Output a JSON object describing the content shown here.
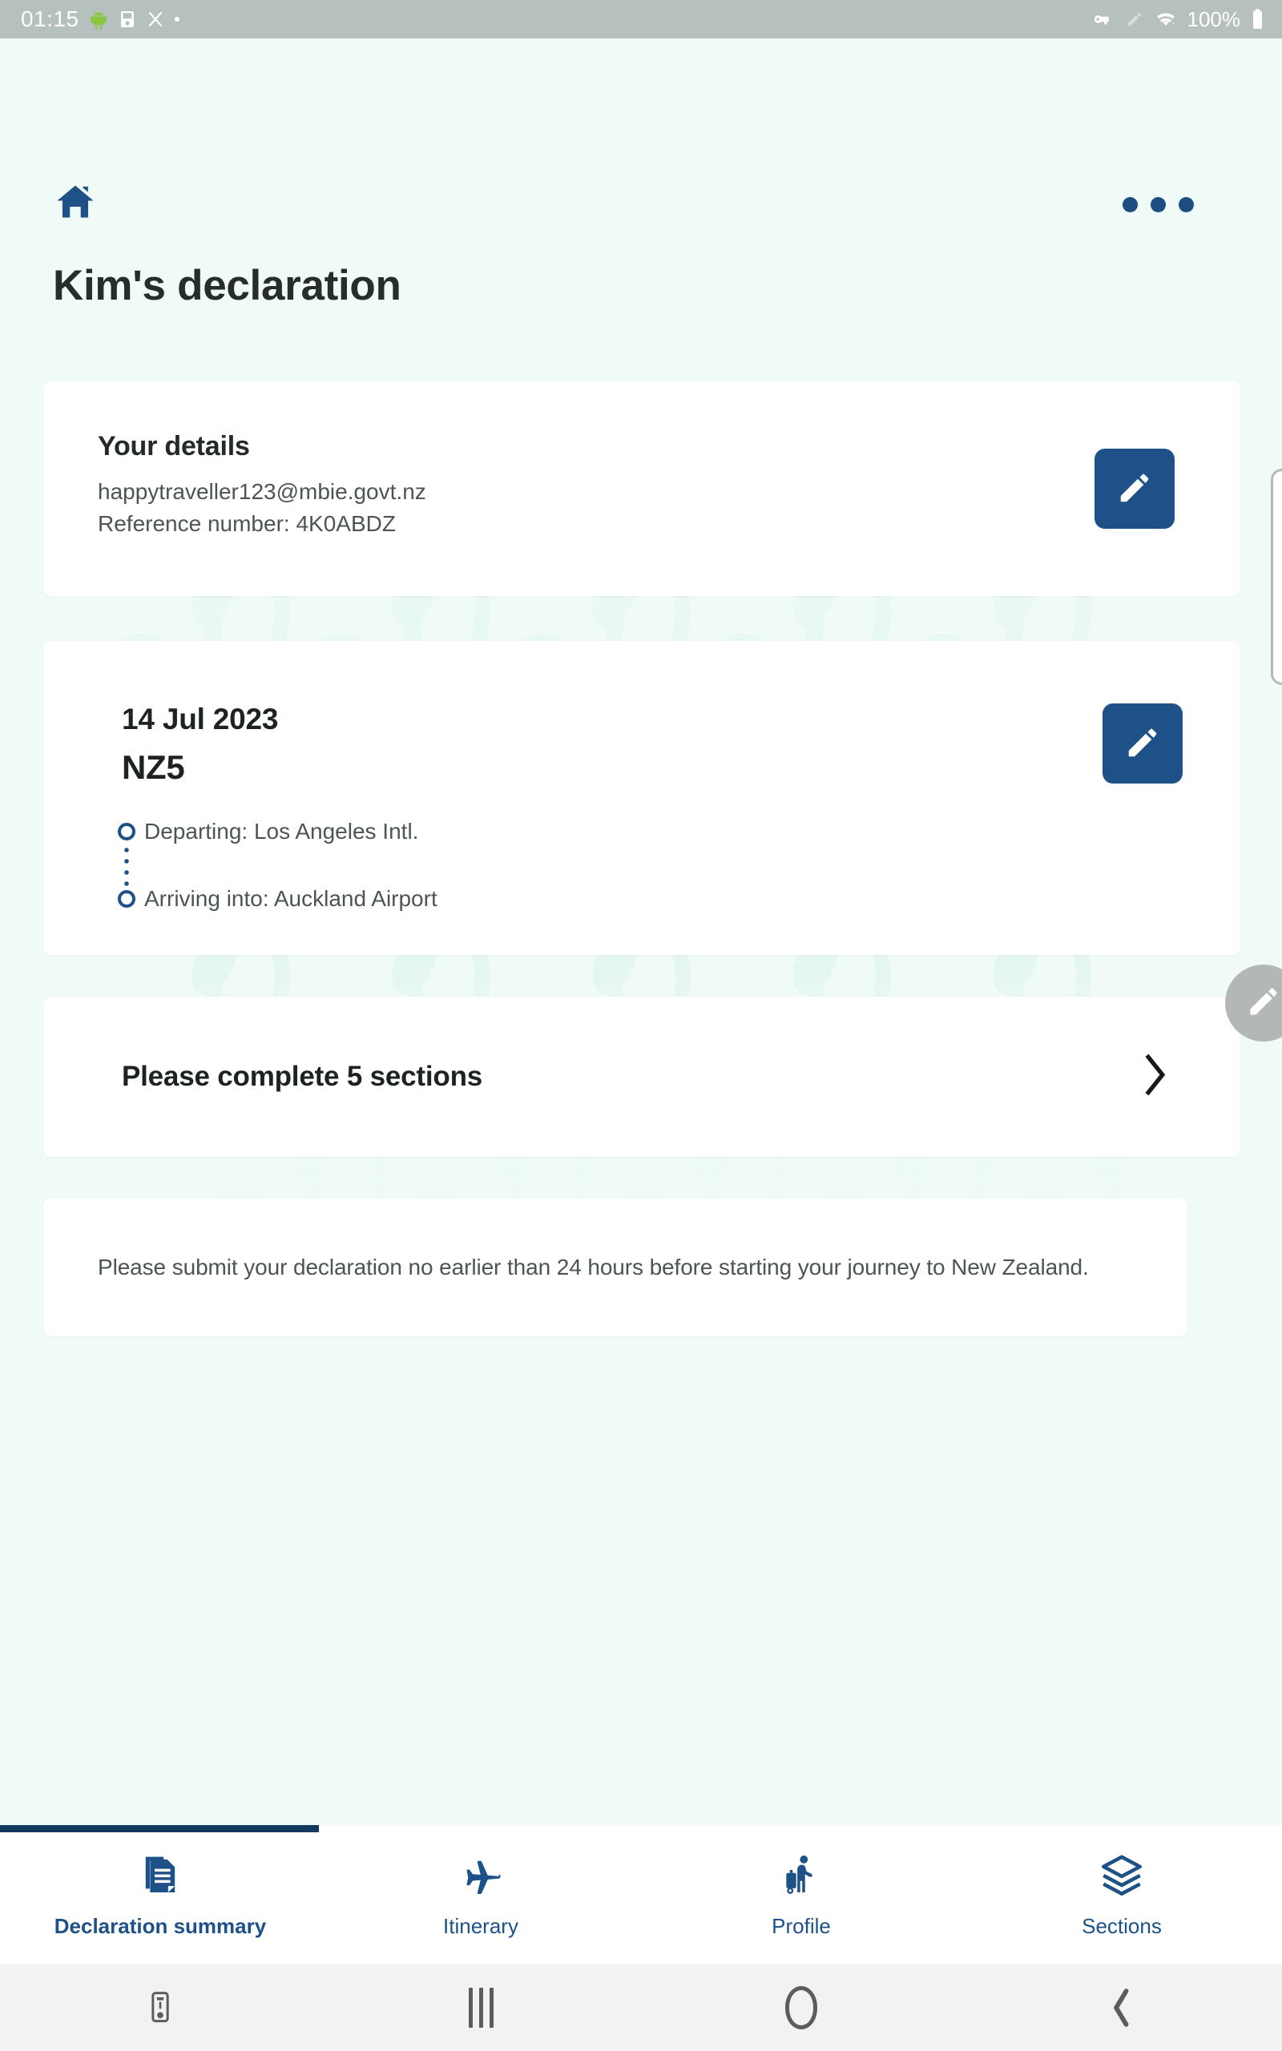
{
  "statusbar": {
    "time": "01:15",
    "battery": "100%",
    "left_icons": [
      "android-robot-icon",
      "screenshot-saved-icon",
      "do-not-disturb-icon",
      "dot-icon"
    ],
    "right_icons": [
      "vpn-key-icon",
      "pencil-icon",
      "wifi-icon",
      "battery-icon"
    ]
  },
  "header": {
    "home_icon": "home-icon",
    "overflow_icon": "more-options-icon",
    "title": "Kim's declaration"
  },
  "details_card": {
    "title": "Your details",
    "email": "happytraveller123@mbie.govt.nz",
    "reference": "Reference number:  4K0ABDZ",
    "edit_icon": "pencil-icon"
  },
  "flight_card": {
    "date": "14 Jul 2023",
    "flight_number": "NZ5",
    "departing": "Departing: Los Angeles Intl.",
    "arriving": "Arriving into: Auckland Airport",
    "edit_icon": "pencil-icon"
  },
  "sections_card": {
    "label": "Please complete 5 sections",
    "chevron_icon": "chevron-right-icon"
  },
  "notice_card": {
    "text": "Please submit your declaration no earlier than 24 hours before starting your journey to New Zealand."
  },
  "floating_action": {
    "icon": "pencil-icon"
  },
  "bottom_nav": {
    "active_index": 0,
    "items": [
      {
        "label": "Declaration summary",
        "icon": "declaration-document-icon"
      },
      {
        "label": "Itinerary",
        "icon": "airplane-icon"
      },
      {
        "label": "Profile",
        "icon": "traveller-suitcase-icon"
      },
      {
        "label": "Sections",
        "icon": "layers-icon"
      }
    ]
  },
  "system_nav": {
    "items": [
      "screenshot-icon",
      "recents-icon",
      "home-icon",
      "back-icon"
    ]
  },
  "colors": {
    "background": "#f0fbf7",
    "card": "#ffffff",
    "primary_blue": "#1d5187",
    "nav_indicator": "#133a5e",
    "statusbar": "#b6c1bf",
    "text": "#262d2b",
    "muted_text": "#4d5553"
  }
}
